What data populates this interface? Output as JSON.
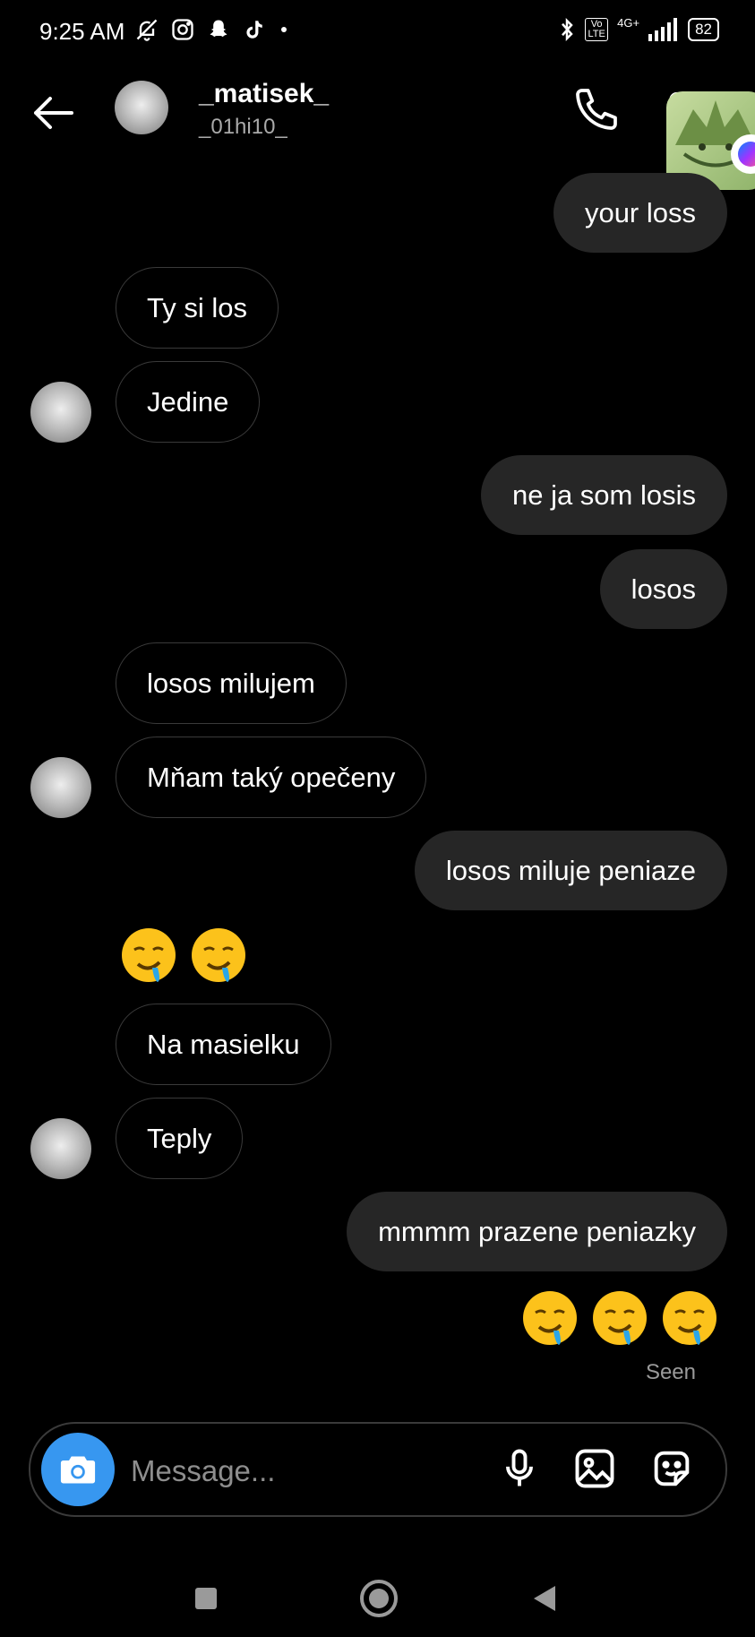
{
  "status_bar": {
    "time": "9:25 AM",
    "network": "4G+",
    "volte": "Vo LTE",
    "battery": "82"
  },
  "header": {
    "name": "_matisek_",
    "username": "_01hi10_"
  },
  "messages": [
    {
      "text": "your loss",
      "dir": "out"
    },
    {
      "text": "Ty si los",
      "dir": "in"
    },
    {
      "text": "Jedine",
      "dir": "in"
    },
    {
      "text": "ne ja som losis",
      "dir": "out"
    },
    {
      "text": "losos",
      "dir": "out"
    },
    {
      "text": "losos milujem",
      "dir": "in"
    },
    {
      "text": "Mňam taký opečeny",
      "dir": "in"
    },
    {
      "text": "losos miluje peniaze",
      "dir": "out"
    },
    {
      "text": "Na masielku",
      "dir": "in"
    },
    {
      "text": "Teply",
      "dir": "in"
    },
    {
      "text": "mmmm prazene peniazky",
      "dir": "out"
    }
  ],
  "emoji_reactions": {
    "incoming": "🤤🤤",
    "outgoing": "🤤🤤🤤"
  },
  "seen_label": "Seen",
  "composer": {
    "placeholder": "Message..."
  },
  "icons": {
    "back": "arrow-left-icon",
    "call": "phone-icon",
    "video": "video-camera-icon",
    "camera": "camera-icon",
    "mic": "microphone-icon",
    "gallery": "image-icon",
    "sticker": "sticker-icon"
  }
}
